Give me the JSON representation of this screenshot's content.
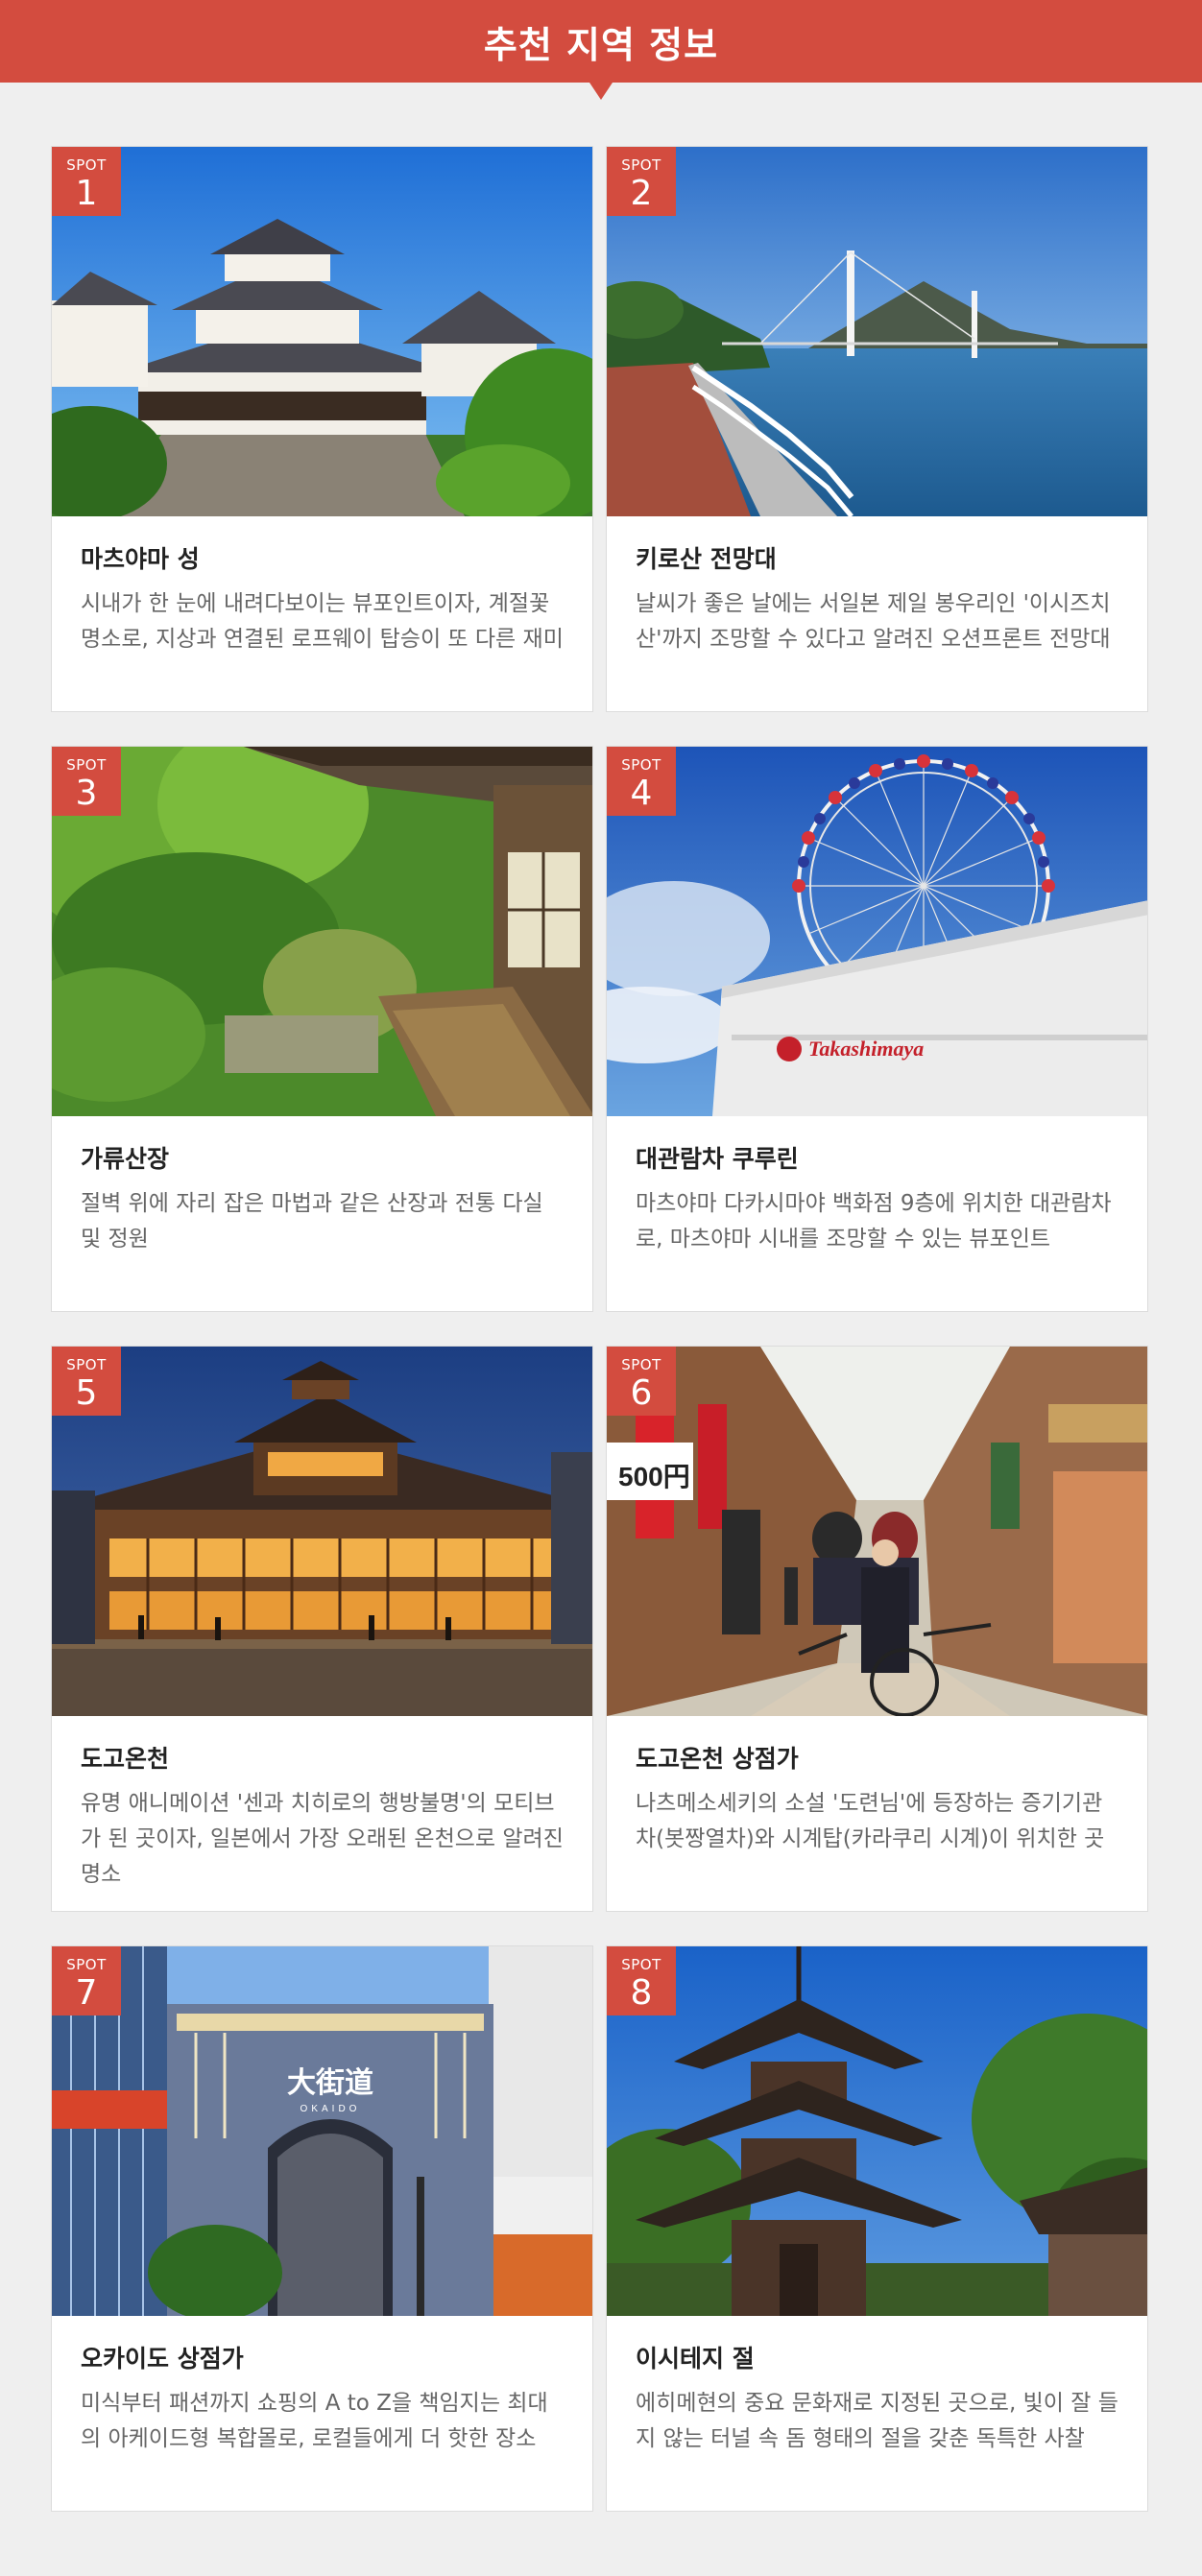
{
  "header": {
    "title": "추천 지역 정보"
  },
  "colors": {
    "accent": "#d34c3f",
    "background": "#efefef",
    "card": "#ffffff"
  },
  "spots": [
    {
      "badge_label": "SPOT",
      "number": "1",
      "title": "마츠야마 성",
      "desc": "시내가 한 눈에 내려다보이는 뷰포인트이자, 계절꽃 명소로, 지상과 연결된 로프웨이 탑승이 또 다른 재미",
      "photo": "castle-photo"
    },
    {
      "badge_label": "SPOT",
      "number": "2",
      "title": "키로산 전망대",
      "desc": "날씨가 좋은 날에는 서일본 제일 봉우리인 '이시즈치 산'까지 조망할 수 있다고 알려진 오션프론트 전망대",
      "photo": "bridge-sea-photo"
    },
    {
      "badge_label": "SPOT",
      "number": "3",
      "title": "가류산장",
      "desc": "절벽 위에 자리 잡은 마법과 같은 산장과 전통 다실 및 정원",
      "photo": "garden-villa-photo"
    },
    {
      "badge_label": "SPOT",
      "number": "4",
      "title": "대관람차 쿠루린",
      "desc": "마츠야마 다카시마야 백화점 9층에 위치한 대관람차로, 마츠야마 시내를 조망할 수 있는 뷰포인트",
      "photo": "ferris-wheel-photo",
      "sign_text": "Takashimaya"
    },
    {
      "badge_label": "SPOT",
      "number": "5",
      "title": "도고온천",
      "desc": "유명 애니메이션 '센과 치히로의 행방불명'의 모티브가 된 곳이자, 일본에서 가장 오래된 온천으로 알려진 명소",
      "photo": "onsen-building-photo"
    },
    {
      "badge_label": "SPOT",
      "number": "6",
      "title": "도고온천 상점가",
      "desc": "나츠메소세키의 소설 '도련님'에 등장하는 증기기관차(봇짱열차)와 시계탑(카라쿠리 시계)이 위치한 곳",
      "photo": "shopping-arcade-rickshaw-photo",
      "sign_text": "500円"
    },
    {
      "badge_label": "SPOT",
      "number": "7",
      "title": "오카이도 상점가",
      "desc": "미식부터 패션까지 쇼핑의 A to Z을 책임지는 최대의 아케이드형 복합몰로, 로컬들에게 더 핫한 장소",
      "photo": "okaido-arcade-photo",
      "sign_text": "大街道",
      "sign_sub": "OKAIDO"
    },
    {
      "badge_label": "SPOT",
      "number": "8",
      "title": "이시테지 절",
      "desc": "에히메현의 중요 문화재로 지정된 곳으로, 빛이 잘 들지 않는 터널 속 돔 형태의 절을 갖춘 독특한 사찰",
      "photo": "pagoda-photo"
    }
  ]
}
